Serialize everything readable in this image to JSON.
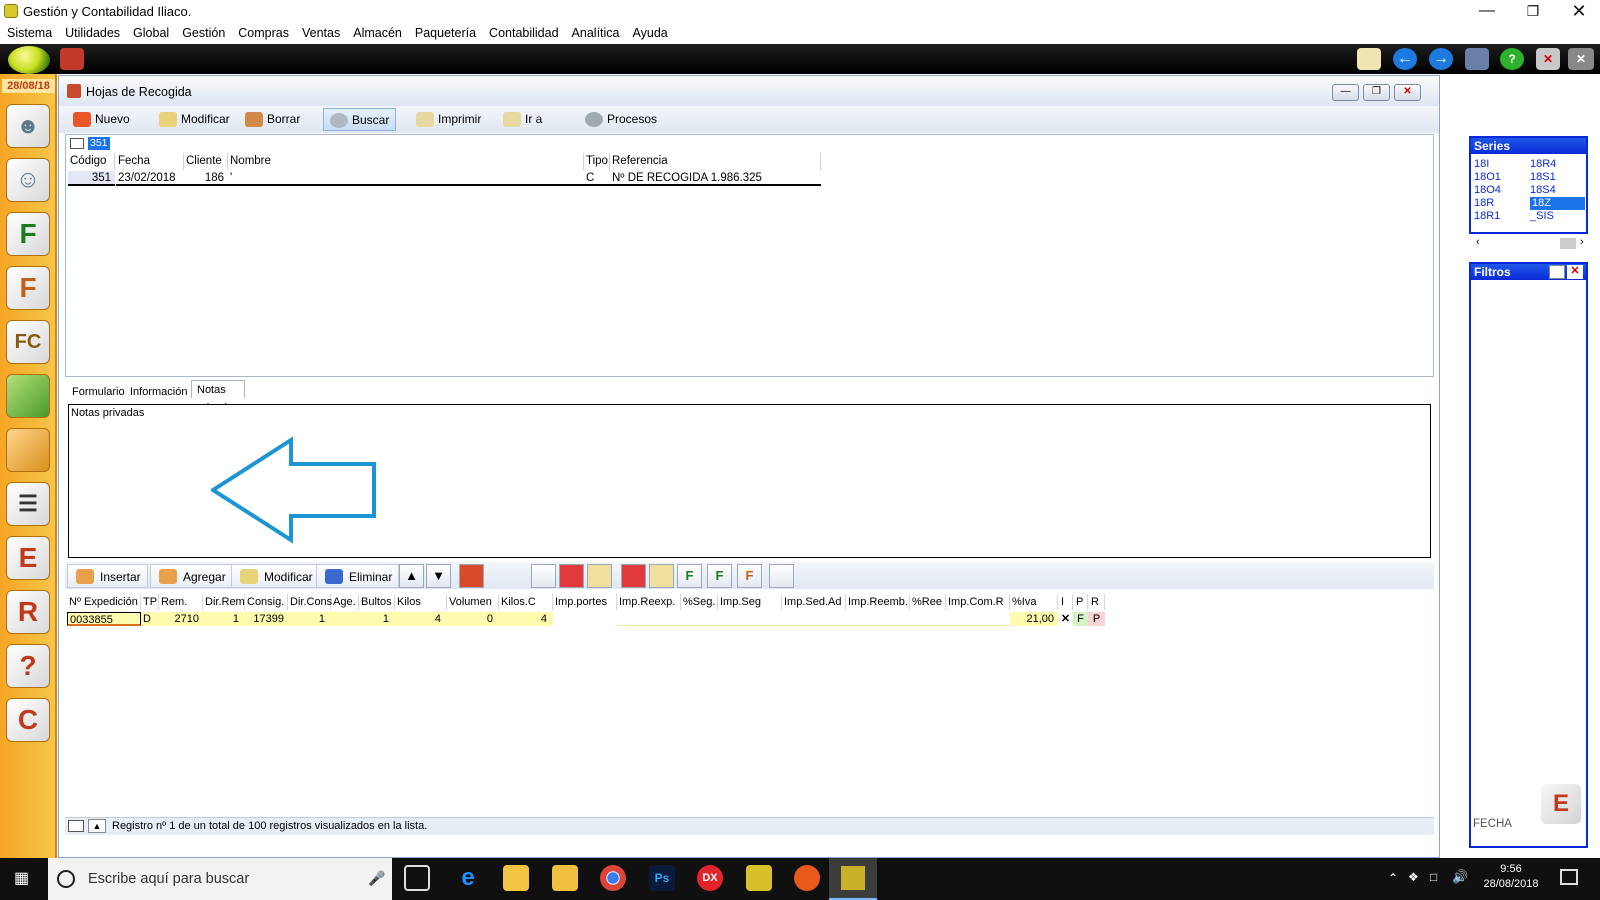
{
  "window": {
    "title": "Gestión y Contabilidad Iliaco."
  },
  "menu": [
    "Sistema",
    "Utilidades",
    "Global",
    "Gestión",
    "Compras",
    "Ventas",
    "Almacén",
    "Paquetería",
    "Contabilidad",
    "Analítica",
    "Ayuda"
  ],
  "sidebar": {
    "date": "28/08/18"
  },
  "child_window": {
    "title": "Hojas de Recogida"
  },
  "toolbar": [
    "Nuevo",
    "Modificar",
    "Borrar",
    "Buscar",
    "Imprimir",
    "Ir a",
    "Procesos"
  ],
  "record_badge": "351",
  "grid": {
    "headers": [
      "Código",
      "Fecha",
      "Cliente",
      "Nombre",
      "Tipo",
      "Referencia"
    ],
    "row": [
      "351",
      "23/02/2018",
      "186",
      "'",
      "C",
      "Nº DE RECOGIDA 1.986.325"
    ]
  },
  "tabs": [
    "Formulario",
    "Información",
    "Notas privadas"
  ],
  "notes_label": "Notas privadas",
  "toolbar2": [
    "Insertar",
    "Agregar",
    "Modificar",
    "Eliminar"
  ],
  "grid2": {
    "headers": [
      "Nº Expedición",
      "TP",
      "Rem.",
      "Dir.Rem",
      "Consig.",
      "Dir.Cons",
      "Age.",
      "Bultos",
      "Kilos",
      "Volumen",
      "Kilos.C",
      "Imp.portes",
      "Imp.Reexp.",
      "%Seg.",
      "Imp.Seg",
      "Imp.Sed.Ad",
      "Imp.Reemb.",
      "%Ree",
      "Imp.Com.R",
      "%Iva",
      "I",
      "P",
      "R"
    ],
    "row": [
      "0033855",
      "D",
      "2710",
      "1",
      "17399",
      "1",
      "",
      "1",
      "4",
      "0",
      "4",
      "",
      "",
      "",
      "",
      "",
      "",
      "",
      "",
      "21,00",
      "✕",
      "F",
      "P"
    ]
  },
  "status": "Registro nº 1 de un total de 100 registros visualizados en la lista.",
  "series": {
    "title": "Series",
    "col1": [
      "18I",
      "18O1",
      "18O4",
      "18R",
      "18R1"
    ],
    "col2": [
      "18R4",
      "18S1",
      "18S4",
      "18Z",
      "_SIS"
    ],
    "selected": "18Z"
  },
  "filtros": {
    "title": "Filtros",
    "footer": "FECHA"
  },
  "taskbar": {
    "search_placeholder": "Escribe aquí para buscar",
    "time": "9:56",
    "date": "28/08/2018"
  }
}
